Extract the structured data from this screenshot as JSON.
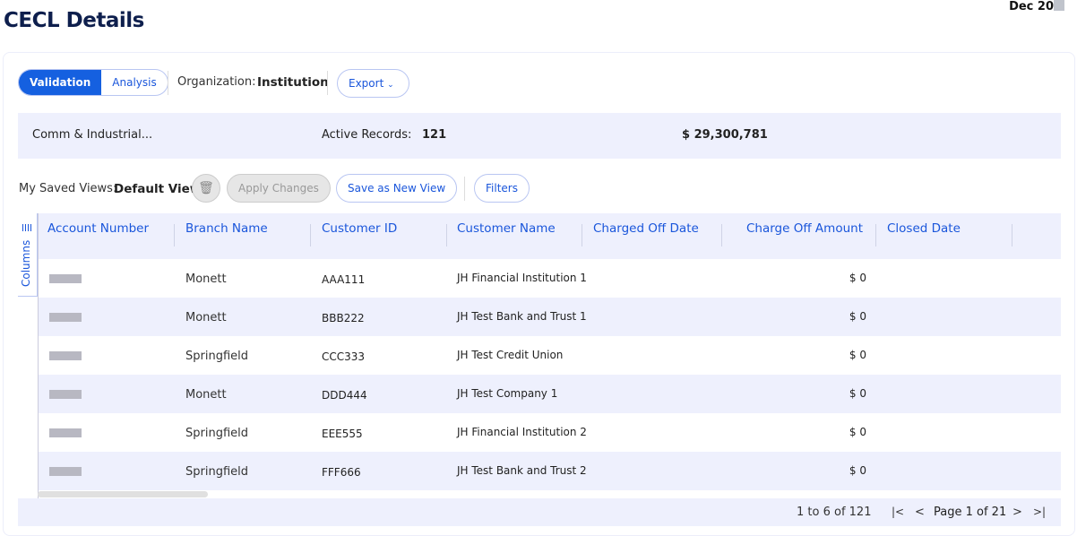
{
  "header": {
    "title": "CECL Details",
    "date": "Dec 20"
  },
  "toolbar": {
    "tabs": [
      {
        "label": "Validation",
        "active": true
      },
      {
        "label": "Analysis",
        "active": false
      }
    ],
    "org_label": "Organization:",
    "org_value": "Institution",
    "export_label": "Export"
  },
  "summary": {
    "category": "Comm & Industrial...",
    "records_label": "Active Records:",
    "records_value": "121",
    "amount": "$ 29,300,781"
  },
  "views": {
    "label": "My Saved Views:",
    "current": "Default View",
    "apply": "Apply Changes",
    "save_new": "Save as New View",
    "filters": "Filters"
  },
  "columns_panel": "Columns",
  "table": {
    "headers": [
      "Account Number",
      "Branch Name",
      "Customer ID",
      "Customer Name",
      "Charged Off Date",
      "Charge Off Amount",
      "Closed Date"
    ],
    "rows": [
      {
        "branch": "Monett",
        "customer_id": "AAA111",
        "customer_name": "JH Financial Institution 1",
        "amount": "$ 0"
      },
      {
        "branch": "Monett",
        "customer_id": "BBB222",
        "customer_name": "JH Test Bank and Trust 1",
        "amount": "$ 0"
      },
      {
        "branch": "Springfield",
        "customer_id": "CCC333",
        "customer_name": "JH Test Credit Union",
        "amount": "$ 0"
      },
      {
        "branch": "Monett",
        "customer_id": "DDD444",
        "customer_name": "JH Test Company 1",
        "amount": "$ 0"
      },
      {
        "branch": "Springfield",
        "customer_id": "EEE555",
        "customer_name": "JH Financial Institution 2",
        "amount": "$ 0"
      },
      {
        "branch": "Springfield",
        "customer_id": "FFF666",
        "customer_name": "JH Test Bank and Trust 2",
        "amount": "$ 0"
      }
    ]
  },
  "pagination": {
    "range": "1 to 6 of 121",
    "page": "Page 1 of 21",
    "first": "|<",
    "prev": "<",
    "next": ">",
    "last": ">|"
  }
}
